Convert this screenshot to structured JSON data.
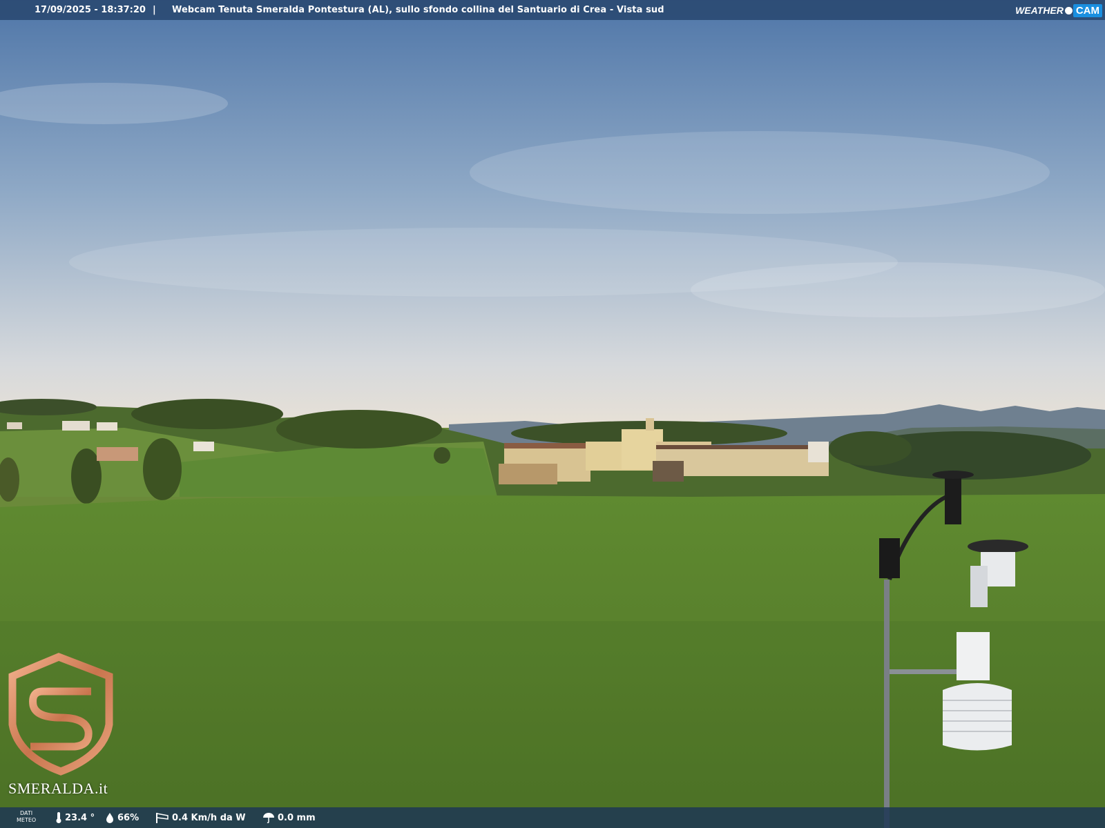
{
  "overlay_top": {
    "timestamp": "17/09/2025 - 18:37:20",
    "separator": "|",
    "title": "Webcam Tenuta Smeralda Pontestura (AL), sullo sfondo collina del Santuario di Crea - Vista sud",
    "brand_weather": "WEATHER",
    "brand_cam": "CAM"
  },
  "overlay_bottom": {
    "dati_line1": "DATI",
    "dati_line2": "METEO",
    "temperature": "23.4 °",
    "humidity": "66%",
    "wind": "0.4 Km/h da W",
    "rain": "0.0 mm"
  },
  "logo": {
    "text": "SMERALDA.it",
    "mark_color": "#d9906a"
  },
  "colors": {
    "bar": "#28466e",
    "brand_accent": "#1a8fe0"
  }
}
